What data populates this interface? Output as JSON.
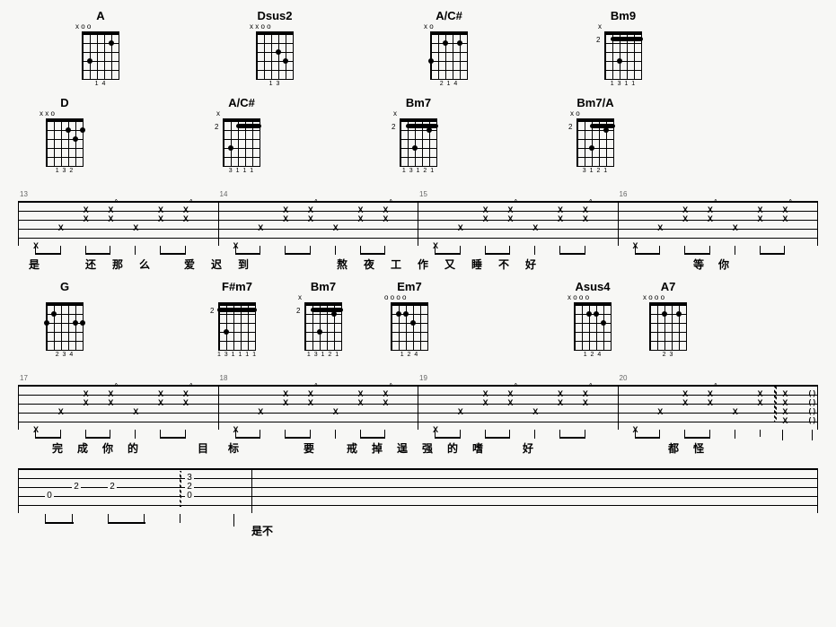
{
  "chord_rows": [
    [
      {
        "name": "A",
        "nut": "x o   o",
        "fingers": "1   4",
        "dots": [
          [
            3,
            1
          ],
          [
            1,
            4
          ]
        ]
      },
      {
        "name": "Dsus2",
        "nut": "x x o   o",
        "fingers": "1 3",
        "dots": [
          [
            2,
            1
          ],
          [
            3,
            3
          ]
        ]
      },
      {
        "name": "A/C#",
        "nut": "x     o",
        "fingers": "2 1   4",
        "dots": [
          [
            3,
            0
          ],
          [
            1,
            2
          ],
          [
            1,
            4
          ]
        ]
      },
      {
        "name": "Bm9",
        "nut": "x",
        "fingers": "1 3 1   1",
        "barre": {
          "fret": 1,
          "from": 1,
          "to": 5
        },
        "dots": [
          [
            3,
            2
          ]
        ],
        "pos": "2"
      }
    ],
    [
      {
        "name": "D",
        "nut": "x x o",
        "fingers": "1 3 2",
        "dots": [
          [
            1,
            3
          ],
          [
            2,
            4
          ],
          [
            1,
            5
          ]
        ]
      },
      {
        "name": "A/C#",
        "nut": "x",
        "fingers": "3 1 1 1",
        "barre": {
          "fret": 1,
          "from": 2,
          "to": 5
        },
        "dots": [
          [
            3,
            1
          ]
        ],
        "pos": "2"
      },
      {
        "name": "Bm7",
        "nut": "x",
        "fingers": "1 3 1 2 1",
        "barre": {
          "fret": 1,
          "from": 1,
          "to": 5
        },
        "dots": [
          [
            3,
            2
          ],
          [
            1,
            4
          ]
        ],
        "pos": "2"
      },
      {
        "name": "Bm7/A",
        "nut": "x o",
        "fingers": "3 1 2 1",
        "barre": {
          "fret": 1,
          "from": 2,
          "to": 5
        },
        "dots": [
          [
            3,
            2
          ],
          [
            1,
            4
          ]
        ],
        "pos": "2"
      }
    ],
    [
      {
        "name": "G",
        "nut": "",
        "fingers": "2   3 4",
        "dots": [
          [
            2,
            0
          ],
          [
            1,
            1
          ],
          [
            2,
            4
          ],
          [
            2,
            5
          ]
        ]
      },
      {
        "name": "F#m7",
        "nut": "",
        "fingers": "1 3 1 1 1 1",
        "barre": {
          "fret": 1,
          "from": 0,
          "to": 5
        },
        "dots": [
          [
            3,
            1
          ]
        ],
        "pos": "2"
      },
      {
        "name": "Bm7",
        "nut": "x",
        "fingers": "1 3 1 2 1",
        "barre": {
          "fret": 1,
          "from": 1,
          "to": 5
        },
        "dots": [
          [
            3,
            2
          ],
          [
            1,
            4
          ]
        ],
        "pos": "2"
      },
      {
        "name": "Em7",
        "nut": "o   o o o",
        "fingers": "1 2 4",
        "dots": [
          [
            1,
            1
          ],
          [
            1,
            2
          ],
          [
            2,
            3
          ]
        ]
      },
      {
        "name": "Asus4",
        "nut": "x o   o o",
        "fingers": "1 2 4",
        "dots": [
          [
            1,
            2
          ],
          [
            1,
            3
          ],
          [
            2,
            4
          ]
        ]
      },
      {
        "name": "A7",
        "nut": "x o   o   o",
        "fingers": "2   3",
        "dots": [
          [
            1,
            2
          ],
          [
            1,
            4
          ]
        ]
      }
    ]
  ],
  "systems": [
    {
      "bars": [
        13,
        14,
        15,
        16
      ],
      "lyrics": [
        "是",
        "",
        "还",
        "那",
        "么",
        "",
        "爱",
        "迟",
        "到",
        "",
        "",
        "",
        "熬",
        "夜",
        "工",
        "作",
        "又",
        "睡",
        "不",
        "好",
        "",
        "",
        "",
        "",
        "",
        "",
        "等",
        "你"
      ],
      "lyric_widths": [
        36,
        30,
        30,
        30,
        30,
        20,
        30,
        30,
        30,
        30,
        30,
        20,
        30,
        30,
        30,
        30,
        30,
        30,
        30,
        30,
        30,
        20,
        30,
        30,
        30,
        18,
        28,
        28
      ]
    },
    {
      "bars": [
        17,
        18,
        19,
        20
      ],
      "lyrics": [
        "",
        "完",
        "成",
        "你",
        "的",
        "",
        "",
        "目",
        "标",
        "",
        "",
        "要",
        "",
        "戒",
        "掉",
        "逞",
        "强",
        "的",
        "嗜",
        "",
        "好",
        "",
        "",
        "",
        "",
        "",
        "都",
        "怪"
      ],
      "lyric_widths": [
        30,
        28,
        28,
        28,
        28,
        28,
        16,
        40,
        28,
        28,
        28,
        28,
        20,
        28,
        28,
        28,
        28,
        28,
        28,
        28,
        28,
        28,
        28,
        28,
        28,
        22,
        28,
        28
      ]
    }
  ],
  "bottom": {
    "frets": [
      "0",
      "2",
      "2",
      "",
      "3",
      "2",
      "0"
    ],
    "label": "是不"
  }
}
